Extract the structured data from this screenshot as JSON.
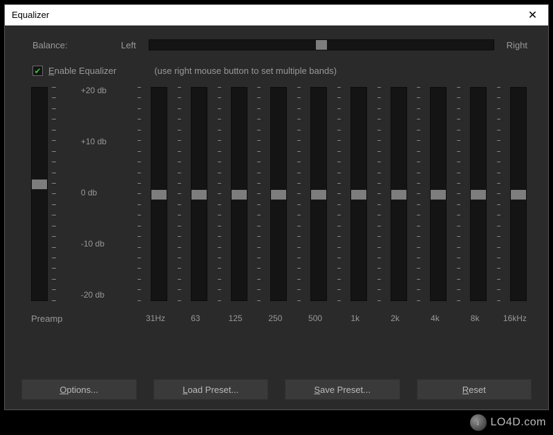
{
  "window": {
    "title": "Equalizer"
  },
  "balance": {
    "label": "Balance:",
    "left": "Left",
    "right": "Right",
    "value_pct": 50
  },
  "enable": {
    "checked": true,
    "label": "Enable Equalizer",
    "hint": "(use right mouse button to set multiple bands)"
  },
  "db_labels": [
    "+20 db",
    "+10 db",
    "0 db",
    "-10 db",
    "-20 db"
  ],
  "preamp": {
    "label": "Preamp",
    "value_db": 2,
    "min_db": -20,
    "max_db": 20
  },
  "bands": [
    {
      "freq": "31Hz",
      "value_db": 0
    },
    {
      "freq": "63",
      "value_db": 0
    },
    {
      "freq": "125",
      "value_db": 0
    },
    {
      "freq": "250",
      "value_db": 0
    },
    {
      "freq": "500",
      "value_db": 0
    },
    {
      "freq": "1k",
      "value_db": 0
    },
    {
      "freq": "2k",
      "value_db": 0
    },
    {
      "freq": "4k",
      "value_db": 0
    },
    {
      "freq": "8k",
      "value_db": 0
    },
    {
      "freq": "16kHz",
      "value_db": 0
    }
  ],
  "buttons": {
    "options": "Options...",
    "load": "Load Preset...",
    "save": "Save Preset...",
    "reset": "Reset"
  },
  "watermark": {
    "logo": "↓",
    "text": "LO4D.com"
  },
  "colors": {
    "panel_bg": "#2a2a2a",
    "track_bg": "#141414",
    "thumb": "#7d7d7d",
    "text": "#999999",
    "button_bg": "#3a3a3a",
    "check_green": "#3fbf3f"
  }
}
